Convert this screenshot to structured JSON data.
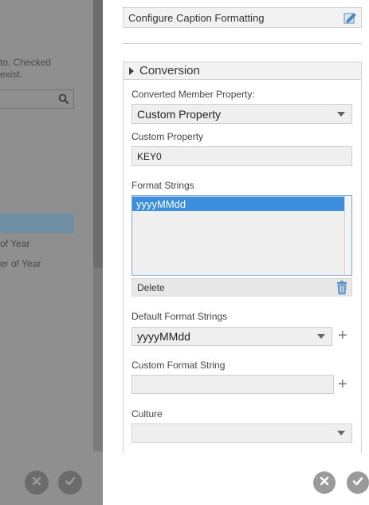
{
  "left_panel": {
    "description_line1": "to. Checked",
    "description_line2": "exist.",
    "list_items": [
      "",
      "of Year",
      "er of Year"
    ],
    "cancel_label": "cancel",
    "ok_label": "ok"
  },
  "dialog": {
    "configure_caption_label": "Configure Caption Formatting",
    "section_title": "Conversion",
    "converted_member_property_label": "Converted Member Property:",
    "converted_member_property_value": "Custom Property",
    "custom_property_label": "Custom Property",
    "custom_property_value": "KEY0",
    "format_strings_label": "Format Strings",
    "format_strings_items": [
      "yyyyMMdd"
    ],
    "delete_label": "Delete",
    "default_format_strings_label": "Default Format Strings",
    "default_format_strings_value": "yyyyMMdd",
    "custom_format_string_label": "Custom Format String",
    "custom_format_string_value": "",
    "culture_label": "Culture",
    "culture_value": ""
  },
  "colors": {
    "selection": "#3d8fde",
    "dim_overlay": "#8f8f8f",
    "left_selection": "#6f8ea3"
  }
}
